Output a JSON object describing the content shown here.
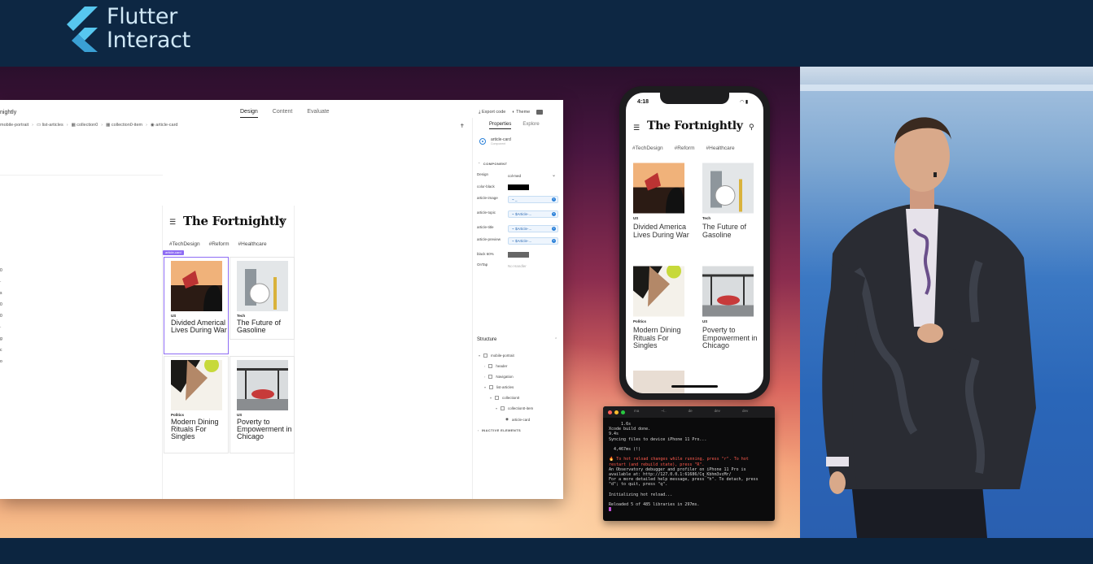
{
  "banner": {
    "brand_line1": "Flutter",
    "brand_line2": "Interact",
    "accent": "#57c7ef"
  },
  "editor": {
    "title": "nightly",
    "tabs": [
      {
        "label": "Design",
        "active": true
      },
      {
        "label": "Content",
        "active": false
      },
      {
        "label": "Evaluate",
        "active": false
      }
    ],
    "breadcrumb": [
      "mobile-portrait",
      "list-articles",
      "collection0",
      "collection0-item",
      "article-card"
    ],
    "actions": {
      "export": "Export code",
      "theme": "Theme"
    },
    "canvas": {
      "app_title": "The Fortnightly",
      "tags": [
        "#TechDesign",
        "#Reform",
        "#Healthcare"
      ],
      "selection_badge": "article-card",
      "cards": [
        {
          "topic": "US",
          "headline": "Divided Americal Lives During War"
        },
        {
          "topic": "Tech",
          "headline": "The Future of Gasoline"
        },
        {
          "topic": "Politics",
          "headline": "Modern Dining Rituals For Singles"
        },
        {
          "topic": "US",
          "headline": "Poverty to Empowerment in Chicago"
        }
      ]
    },
    "props": {
      "tabs": [
        {
          "label": "Properties",
          "active": true
        },
        {
          "label": "Explore",
          "active": false
        }
      ],
      "selected": "article-card",
      "selected_sub": "Component",
      "component_header": "COMPONENT",
      "rows": [
        {
          "label": "Design",
          "value": "col-med"
        },
        {
          "label": "color-black",
          "swatch": "#000000"
        },
        {
          "label": "article-image",
          "chip": "_"
        },
        {
          "label": "article-topic",
          "chip": "$Article-..."
        },
        {
          "label": "article-title",
          "chip": "$Article-..."
        },
        {
          "label": "article-preview",
          "chip": "$Article-..."
        },
        {
          "label": "black 60%",
          "swatch": "#666666"
        },
        {
          "label": "OnTap",
          "value": "No Handler"
        }
      ],
      "structure_title": "Structure",
      "tree": [
        {
          "label": "mobile-portrait",
          "depth": 0
        },
        {
          "label": "header",
          "depth": 1
        },
        {
          "label": "Navigation",
          "depth": 1
        },
        {
          "label": "list-articles",
          "depth": 1
        },
        {
          "label": "collection0",
          "depth": 2
        },
        {
          "label": "collection0-item",
          "depth": 3
        },
        {
          "label": "article-card",
          "depth": 4
        }
      ],
      "inactive_header": "INACTIVE ELEMENTS"
    }
  },
  "phone": {
    "time": "4:18",
    "app_title": "The Fortnightly",
    "tags": [
      "#TechDesign",
      "#Reform",
      "#Healthcare"
    ],
    "cards": [
      {
        "topic": "US",
        "headline": "Divided America Lives During War"
      },
      {
        "topic": "Tech",
        "headline": "The Future of Gasoline"
      },
      {
        "topic": "Politics",
        "headline": "Modern Dining Rituals For Singles"
      },
      {
        "topic": "US",
        "headline": "Poverty to Empowerment in Chicago"
      }
    ]
  },
  "terminal": {
    "tabs": [
      "ma",
      "~/..",
      "de",
      "dev",
      "dev"
    ],
    "lines": [
      "     1.6s",
      "Xcode build done.",
      "9.4s",
      "Syncing files to device iPhone 11 Pro...",
      "",
      "  4,467ms (!)",
      ""
    ],
    "hot_reload_red": "🔥 To hot reload changes while running, press \"r\". To hot\nrestart (and rebuild state), press \"R\".",
    "lines2": [
      "An Observatory debugger and profiler on iPhone 11 Pro is",
      "available at: http://127.0.0.1:61686/Cq_Kbhm3vcMr/",
      "For a more detailed help message, press \"h\". To detach, press",
      "\"d\"; to quit, press \"q\".",
      "",
      "Initializing hot reload...",
      "",
      "Reloaded 5 of 485 libraries in 297ms."
    ]
  }
}
